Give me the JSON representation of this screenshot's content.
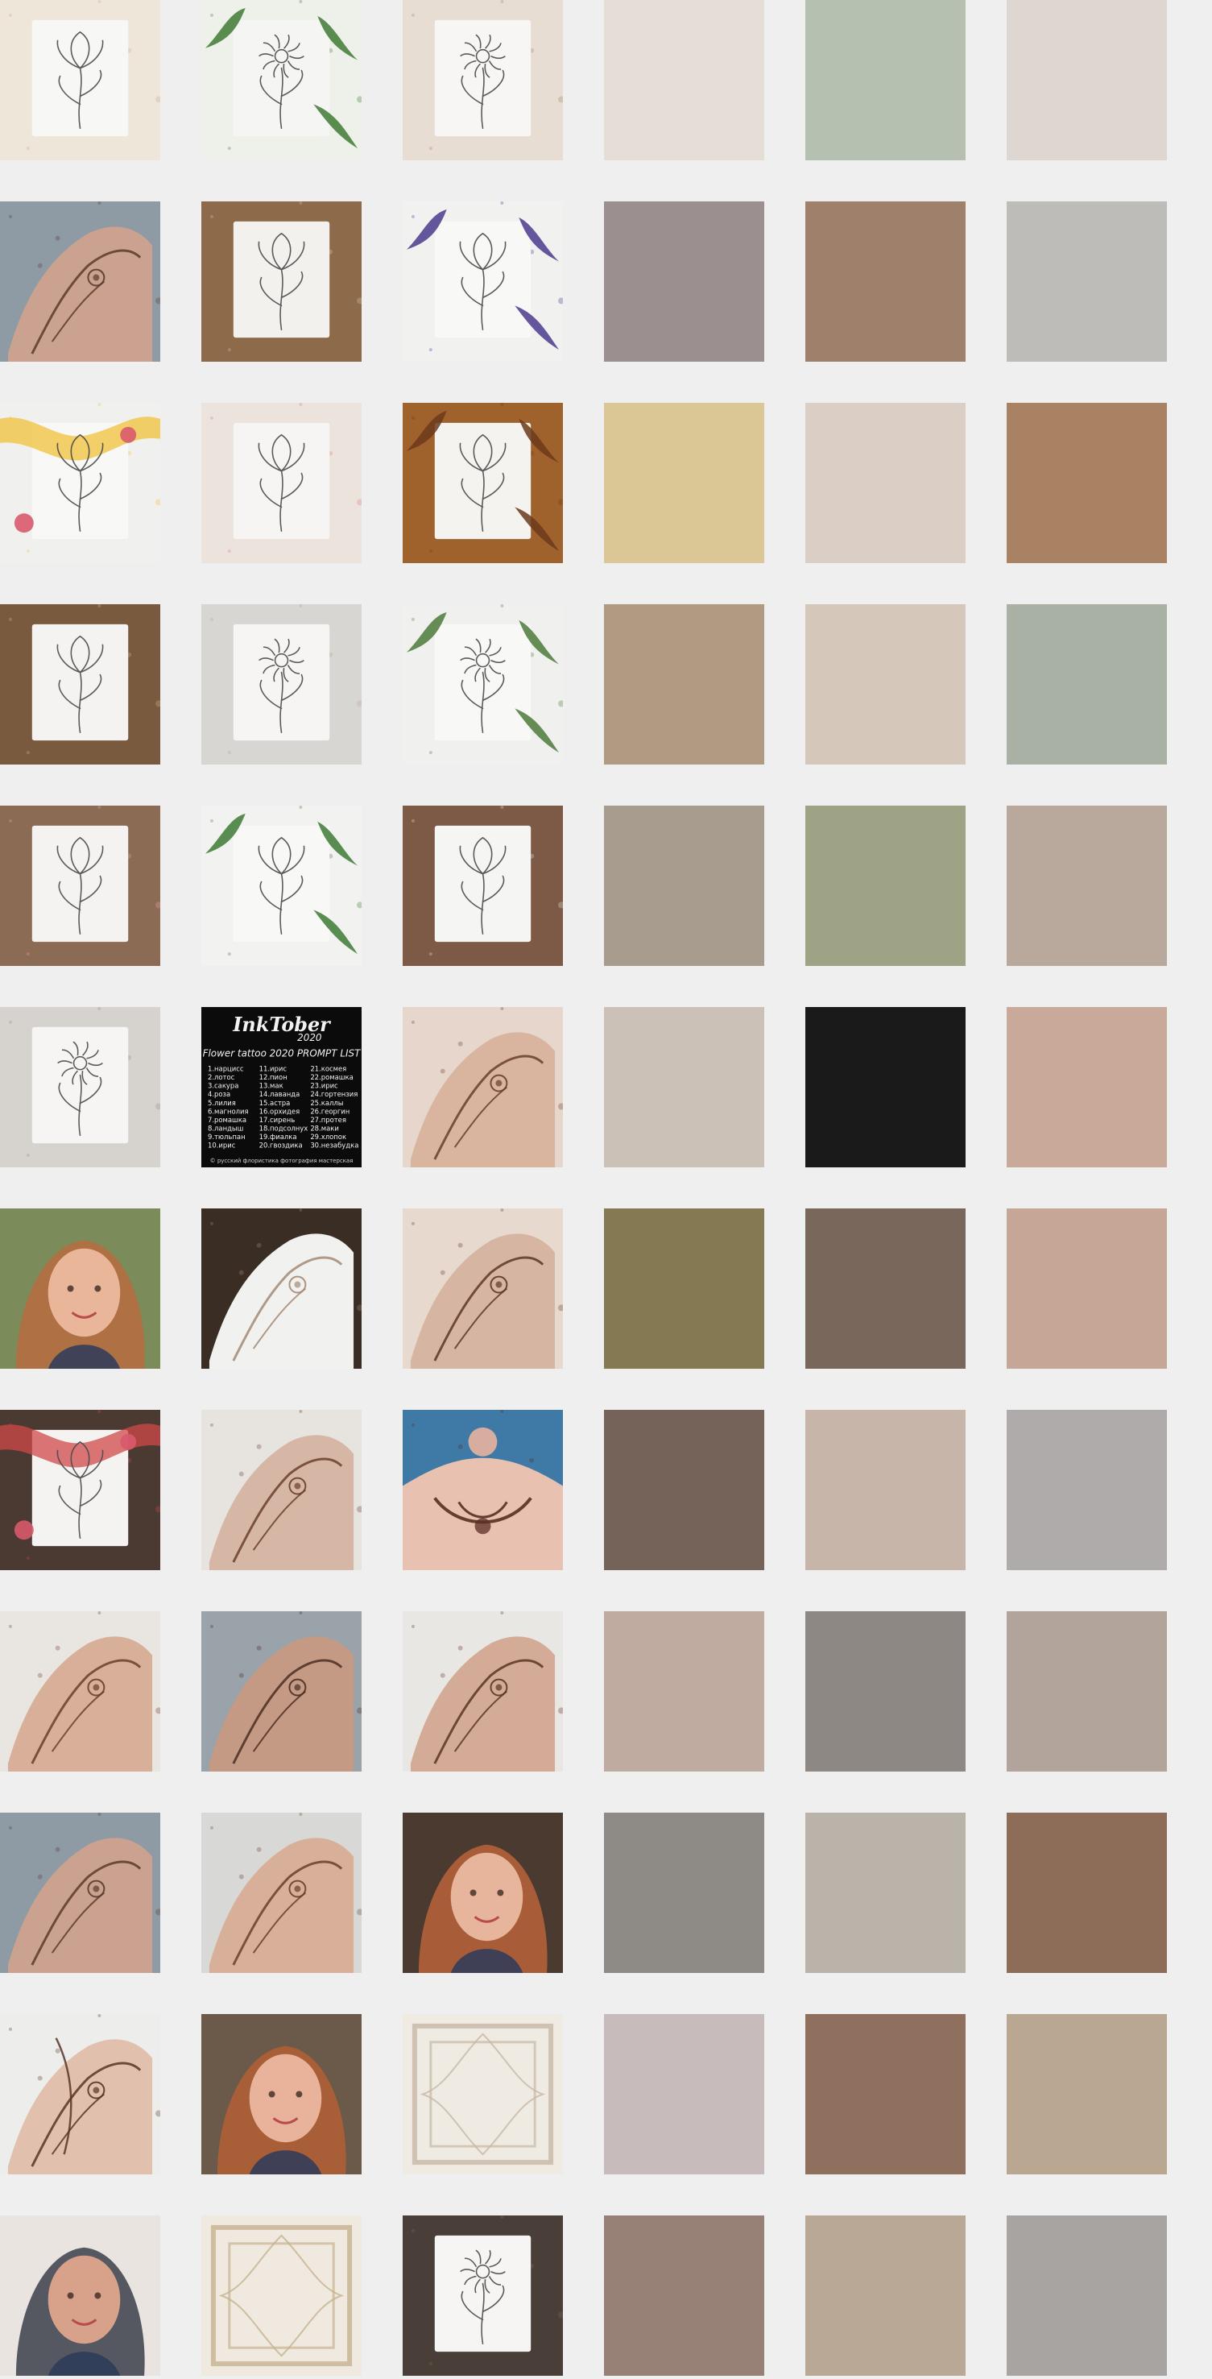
{
  "rows": [
    {
      "photos": [
        {
          "name": "lily-drawing-photo",
          "bg": "#efe6da",
          "paper": "#f7f7f5",
          "accent": "#c7a98c",
          "motif": "lily"
        },
        {
          "name": "peony-drawing-photo",
          "bg": "#eef0ea",
          "paper": "#f5f5f3",
          "accent": "#3f7a35",
          "motif": "peony"
        },
        {
          "name": "daisy-drawing-photo",
          "bg": "#e7ddd3",
          "paper": "#f7f6f4",
          "accent": "#a98768",
          "motif": "daisy"
        }
      ],
      "swatches": [
        "#e4ded6",
        "#b6c0b1",
        "#ddd6d1"
      ]
    },
    {
      "photos": [
        {
          "name": "henna-hands-photo",
          "bg": "#8e9aa4",
          "paper": "#caa28f",
          "accent": "#5a3b2e",
          "motif": "hands"
        },
        {
          "name": "calla-drawing-photo",
          "bg": "#8c6a4a",
          "paper": "#f3f1ee",
          "accent": "#d9c2ac",
          "motif": "lily"
        },
        {
          "name": "iris-drawing-photo",
          "bg": "#f1f1f0",
          "paper": "#f8f8f7",
          "accent": "#4c3a8e",
          "motif": "iris"
        }
      ],
      "swatches": [
        "#9b8f8f",
        "#9f806b",
        "#bdbcb8"
      ]
    },
    {
      "photos": [
        {
          "name": "rose-ribbon-photo",
          "bg": "#f0f0ee",
          "paper": "#f8f8f7",
          "accent": "#f2c23a",
          "motif": "rose"
        },
        {
          "name": "tulip-drawing-photo",
          "bg": "#ebe3dc",
          "paper": "#f7f5f3",
          "accent": "#d6828d",
          "motif": "tulip"
        },
        {
          "name": "autumn-drawing-photo",
          "bg": "#a0622d",
          "paper": "#f4f3f0",
          "accent": "#6b3a1a",
          "motif": "branch"
        }
      ],
      "swatches": [
        "#dbc796",
        "#dbcfc5",
        "#a88262"
      ]
    },
    {
      "photos": [
        {
          "name": "bouquet-drawing-photo",
          "bg": "#7a5a3f",
          "paper": "#f4f3f1",
          "accent": "#d4b58f",
          "motif": "bouquet"
        },
        {
          "name": "magnolia-drawing-photo",
          "bg": "#d8d6d2",
          "paper": "#f6f5f3",
          "accent": "#b8a494",
          "motif": "magnolia"
        },
        {
          "name": "poppy-drawing-photo",
          "bg": "#f0f0ee",
          "paper": "#f8f8f7",
          "accent": "#4d7a3a",
          "motif": "poppy"
        }
      ],
      "swatches": [
        "#b09a82",
        "#d5c8ba",
        "#a9b1a4"
      ]
    },
    {
      "photos": [
        {
          "name": "sketchbook-roses-photo",
          "bg": "#8b6b54",
          "paper": "#f4f3f1",
          "accent": "#e7a6a6",
          "motif": "roses"
        },
        {
          "name": "branch-leaves-photo",
          "bg": "#f2f2f0",
          "paper": "#f8f8f7",
          "accent": "#3e7a34",
          "motif": "branch"
        },
        {
          "name": "cat-tulip-photo",
          "bg": "#7d5a45",
          "paper": "#f5f5f3",
          "accent": "#e7e1d6",
          "motif": "tulip"
        }
      ],
      "swatches": [
        "#a89c8e",
        "#9ea385",
        "#b9a99c"
      ]
    },
    {
      "photos": [
        {
          "name": "daffodil-drawing-photo",
          "bg": "#d6d3cf",
          "paper": "#f6f5f3",
          "accent": "#9b8b7a",
          "motif": "daffodil"
        },
        {
          "name": "inktober-prompt-list",
          "bg": "#0b0b0b",
          "paper": "#0b0b0b",
          "accent": "#f2f2f2",
          "motif": "prompt"
        },
        {
          "name": "henna-hands-floral-photo",
          "bg": "#e7d6cc",
          "paper": "#d9b59f",
          "accent": "#6a3d2b",
          "motif": "hands"
        }
      ],
      "swatches": [
        "#cbc1b6",
        "#1a1a1a",
        "#c9aa9a"
      ]
    },
    {
      "photos": [
        {
          "name": "portrait-hydrangea-photo",
          "bg": "#7b8b5a",
          "paper": "#e9b69a",
          "accent": "#b86b3f",
          "motif": "portrait"
        },
        {
          "name": "hand-sketch-dark-photo",
          "bg": "#3a2d24",
          "paper": "#f1f1ef",
          "accent": "#a58a73",
          "motif": "hands"
        },
        {
          "name": "henna-hands-bed-photo",
          "bg": "#e8d9cf",
          "paper": "#d6b6a2",
          "accent": "#5e3628",
          "motif": "hands"
        }
      ],
      "swatches": [
        "#857954",
        "#78675a",
        "#c6a696"
      ]
    },
    {
      "photos": [
        {
          "name": "watercolor-rose-photo",
          "bg": "#4a3a31",
          "paper": "#f4f3f1",
          "accent": "#d24a4a",
          "motif": "rose"
        },
        {
          "name": "henna-arm-photo",
          "bg": "#e7e3de",
          "paper": "#d6b7a5",
          "accent": "#6a3f2c",
          "motif": "hands"
        },
        {
          "name": "henna-chest-photo",
          "bg": "#3f79a6",
          "paper": "#e8c1b0",
          "accent": "#5a2f24",
          "motif": "chest"
        }
      ],
      "swatches": [
        "#75635a",
        "#c8b5aa",
        "#b0abab"
      ]
    },
    {
      "photos": [
        {
          "name": "henna-forearm-photo",
          "bg": "#e9e6e1",
          "paper": "#d8b09a",
          "accent": "#6a3f2c",
          "motif": "hands"
        },
        {
          "name": "henna-hands-wheat-photo",
          "bg": "#9aa2aa",
          "paper": "#c49a85",
          "accent": "#4b2e22",
          "motif": "hands"
        },
        {
          "name": "henna-hands-white-photo",
          "bg": "#e9e7e4",
          "paper": "#d3ab96",
          "accent": "#5c3425",
          "motif": "hands"
        }
      ],
      "swatches": [
        "#c0aba0",
        "#8e8884",
        "#b3a49b"
      ]
    },
    {
      "photos": [
        {
          "name": "henna-hands-repeat-photo",
          "bg": "#8e9aa4",
          "paper": "#caa28f",
          "accent": "#5a3b2e",
          "motif": "hands"
        },
        {
          "name": "henna-lace-photo",
          "bg": "#d8d8d6",
          "paper": "#d8b09a",
          "accent": "#6a3f2c",
          "motif": "hands"
        },
        {
          "name": "face-henna-portrait-photo",
          "bg": "#4a3a30",
          "paper": "#e7b59c",
          "accent": "#b8643a",
          "motif": "portrait"
        }
      ],
      "swatches": [
        "#8e8a85",
        "#b9b3aa",
        "#8d6c58"
      ]
    },
    {
      "photos": [
        {
          "name": "henna-leg-photo",
          "bg": "#ededeb",
          "paper": "#e2c0ae",
          "accent": "#5a3526",
          "motif": "leg"
        },
        {
          "name": "forehead-henna-portrait",
          "bg": "#6b5a4a",
          "paper": "#e8b39a",
          "accent": "#b35f34",
          "motif": "portrait"
        },
        {
          "name": "ceiling-ornament-photo",
          "bg": "#e7e2d8",
          "paper": "#efeae2",
          "accent": "#c8b8a6",
          "motif": "ceiling"
        }
      ],
      "swatches": [
        "#c7bbbc",
        "#8f6f5d",
        "#b9a792"
      ]
    },
    {
      "photos": [
        {
          "name": "girl-with-cat-photo",
          "bg": "#e9e4df",
          "paper": "#d8a18a",
          "accent": "#3b3f4a",
          "motif": "portrait"
        },
        {
          "name": "chandelier-ceiling-photo",
          "bg": "#e7e1d6",
          "paper": "#efe9df",
          "accent": "#c7b28f",
          "motif": "ceiling"
        },
        {
          "name": "lotus-drawing-book-photo",
          "bg": "#4a3f38",
          "paper": "#f6f5f3",
          "accent": "#7a6b5f",
          "motif": "lotus"
        }
      ],
      "swatches": [
        "#978075",
        "#b8a895",
        "#a8a4a1"
      ]
    }
  ],
  "prompt": {
    "logo_line1": "InkTober",
    "logo_line2": "2020",
    "heading": "Flower tattoo 2020 PROMPT LIST",
    "col1": [
      "1.нарцисс",
      "2.лотос",
      "3.сакура",
      "4.роза",
      "5.лилия",
      "6.магнолия",
      "7.ромашка",
      "8.ландыш",
      "9.тюльпан",
      "10.ирис"
    ],
    "col2": [
      "11.ирис",
      "12.пион",
      "13.мак",
      "14.лаванда",
      "15.астра",
      "16.орхидея",
      "17.сирень",
      "18.подсолнух",
      "19.фиалка",
      "20.гвоздика"
    ],
    "col3": [
      "21.космея",
      "22.ромашка",
      "23.ирис",
      "24.гортензия",
      "25.каллы",
      "26.георгин",
      "27.протея",
      "28.маки",
      "29.хлопок",
      "30.незабудка"
    ],
    "footer": "© русский флористика фотография мастерская"
  }
}
